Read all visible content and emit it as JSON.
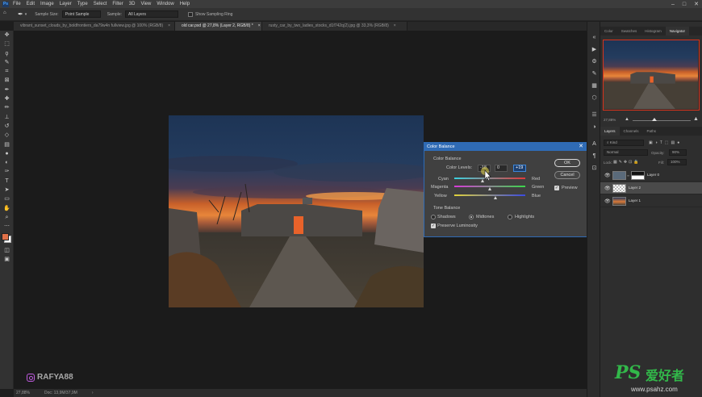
{
  "menubar": {
    "logo": "Ps",
    "items": [
      "File",
      "Edit",
      "Image",
      "Layer",
      "Type",
      "Select",
      "Filter",
      "3D",
      "View",
      "Window",
      "Help"
    ],
    "window_controls": [
      "–",
      "□",
      "✕"
    ]
  },
  "options": {
    "sample_size_label": "Sample Size:",
    "sample_size_value": "Point Sample",
    "sample_label": "Sample:",
    "sample_value": "All Layers",
    "show_ring_label": "Show Sampling Ring"
  },
  "tabs": [
    {
      "label": "vibrant_sunset_clouds_by_boldfrontiers_da79w4n fullview.jpg @ 100% (RGB/8)",
      "close": "×"
    },
    {
      "label": "old car.psd @ 27,8% (Layer 2, RGB/8) *",
      "close": "×"
    },
    {
      "label": "rusty_car_by_two_ladies_stocks_d1f742q(2).jpg @ 33,3% (RGB/8)",
      "close": "×"
    }
  ],
  "toolbar": {
    "tools": [
      "move-tool",
      "marquee-tool",
      "lasso-tool",
      "quick-select-tool",
      "crop-tool",
      "frame-tool",
      "eyedropper-tool",
      "healing-tool",
      "brush-tool",
      "stamp-tool",
      "history-brush-tool",
      "eraser-tool",
      "gradient-tool",
      "blur-tool",
      "dodge-tool",
      "pen-tool",
      "type-tool",
      "path-select-tool",
      "shape-tool",
      "hand-tool",
      "zoom-tool",
      "more-tools"
    ],
    "glyphs": [
      "✥",
      "⬚",
      "ϙ",
      "✎",
      "⌗",
      "⊠",
      "✒",
      "✚",
      "✏",
      "⊥",
      "↺",
      "◇",
      "▤",
      "●",
      "◐",
      "✑",
      "T",
      "➤",
      "▭",
      "✋",
      "⌕",
      "⋯"
    ],
    "fg_color": "#e07048",
    "bg_color": "#ffffff"
  },
  "status": {
    "zoom": "27,88%",
    "doc": "Doc: 13,9M/37,9M",
    "arrow": "›"
  },
  "watermark": "RAFYA88",
  "dialog": {
    "title": "Color Balance",
    "close": "✕",
    "section_color": "Color Balance",
    "levels_label": "Color Levels:",
    "levels": [
      "-18",
      "0",
      "+19"
    ],
    "sliders": [
      {
        "left": "Cyan",
        "right": "Red",
        "position": 0.4
      },
      {
        "left": "Magenta",
        "right": "Green",
        "position": 0.5
      },
      {
        "left": "Yellow",
        "right": "Blue",
        "position": 0.59
      }
    ],
    "ok": "OK",
    "cancel": "Cancel",
    "preview": "Preview",
    "section_tone": "Tone Balance",
    "tones": [
      "Shadows",
      "Midtones",
      "Highlights"
    ],
    "selected_tone": "Midtones",
    "preserve": "Preserve Luminosity"
  },
  "panels": {
    "top_tabs": [
      "Color",
      "Swatches",
      "Histogram",
      "Navigator"
    ],
    "nav_zoom": "27,88%",
    "layer_tabs": [
      "Layers",
      "Channels",
      "Paths"
    ],
    "kind_filter": "Kind",
    "blend_mode": "Normal",
    "opacity_label": "Opacity:",
    "opacity_value": "90%",
    "lock_label": "Lock:",
    "fill_label": "Fill:",
    "fill_value": "100%",
    "layers": [
      "Layer 0",
      "Layer 2",
      "Layer 1"
    ],
    "selected_layer": "Layer 2"
  },
  "brand": {
    "ps": "PS",
    "cn": "爱好者",
    "url": "www.psahz.com"
  }
}
